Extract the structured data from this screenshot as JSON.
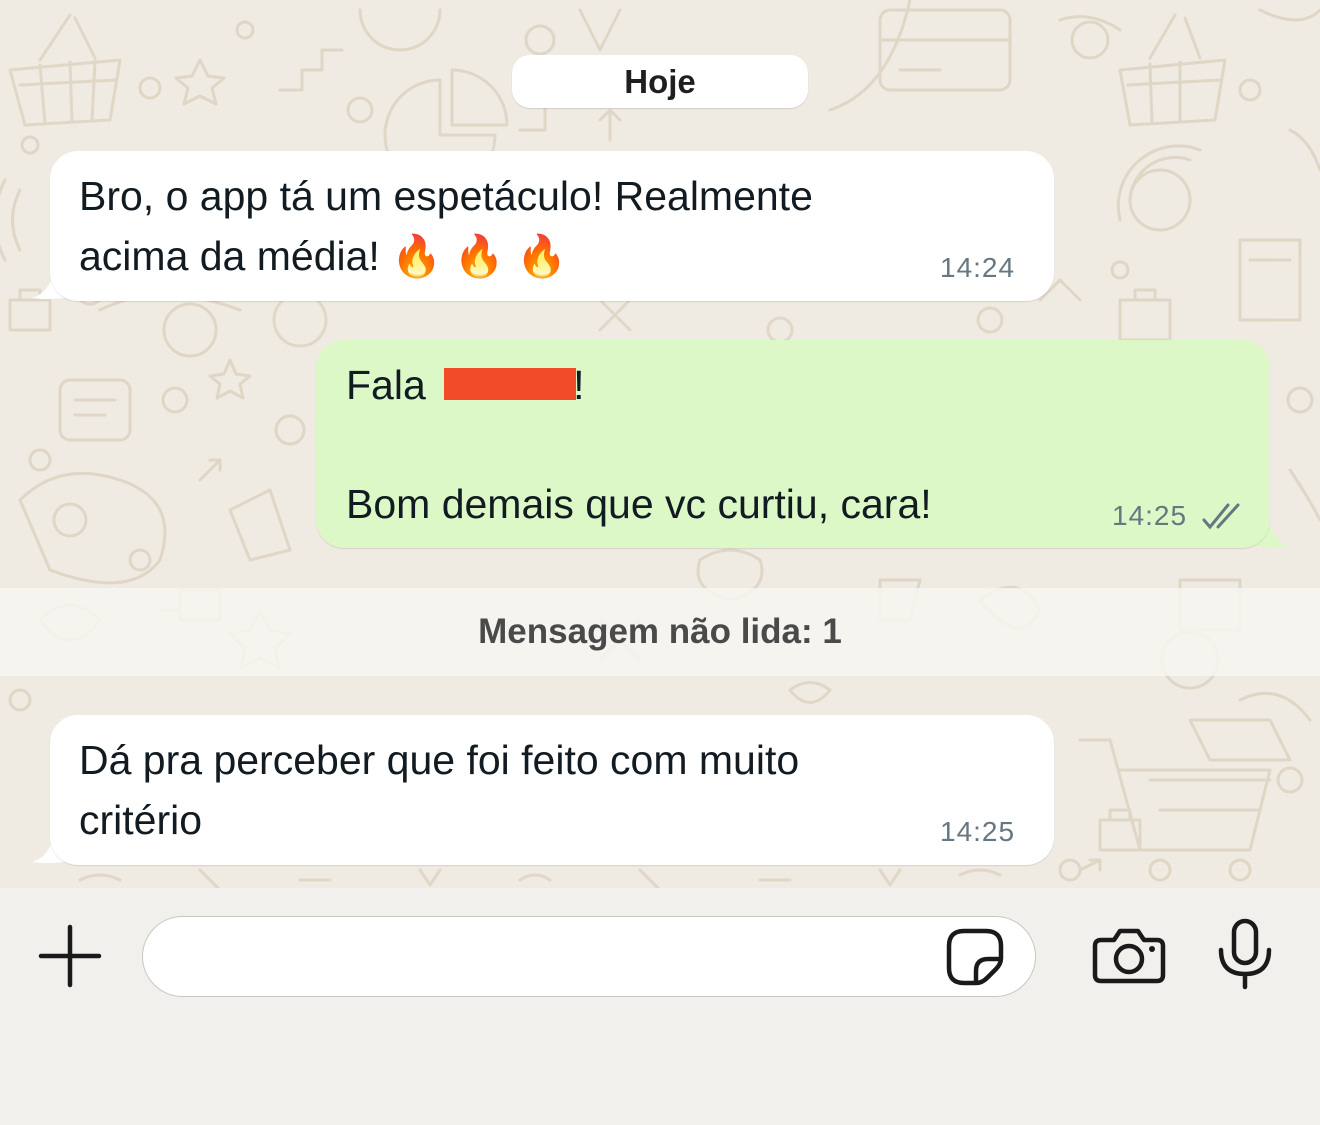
{
  "chat": {
    "date_label": "Hoje",
    "messages": [
      {
        "direction": "incoming",
        "lines": [
          "Bro, o app tá um espetáculo! Realmente",
          "acima da média! 🔥 🔥 🔥"
        ],
        "time": "14:24"
      },
      {
        "direction": "outgoing",
        "lines": [
          "Fala ████!",
          "",
          "Bom demais que vc curtiu, cara!"
        ],
        "line_1_prefix": "Fala ",
        "line_1_suffix": "!",
        "time": "14:25",
        "status_icon": "double-check-icon"
      },
      {
        "direction": "incoming",
        "lines": [
          "Dá pra perceber que foi feito com muito",
          "critério"
        ],
        "time": "14:25"
      }
    ],
    "unread_label": "Mensagem não lida: 1"
  },
  "composer": {
    "input_value": "",
    "icons": [
      "plus-icon",
      "sticker-icon",
      "camera-icon",
      "microphone-icon"
    ]
  },
  "colors": {
    "wallpaper": "#efeae2",
    "incoming_bubble": "#ffffff",
    "outgoing_bubble": "#dcf8c6",
    "redaction": "#f24b2a",
    "timestamp": "#667781"
  }
}
